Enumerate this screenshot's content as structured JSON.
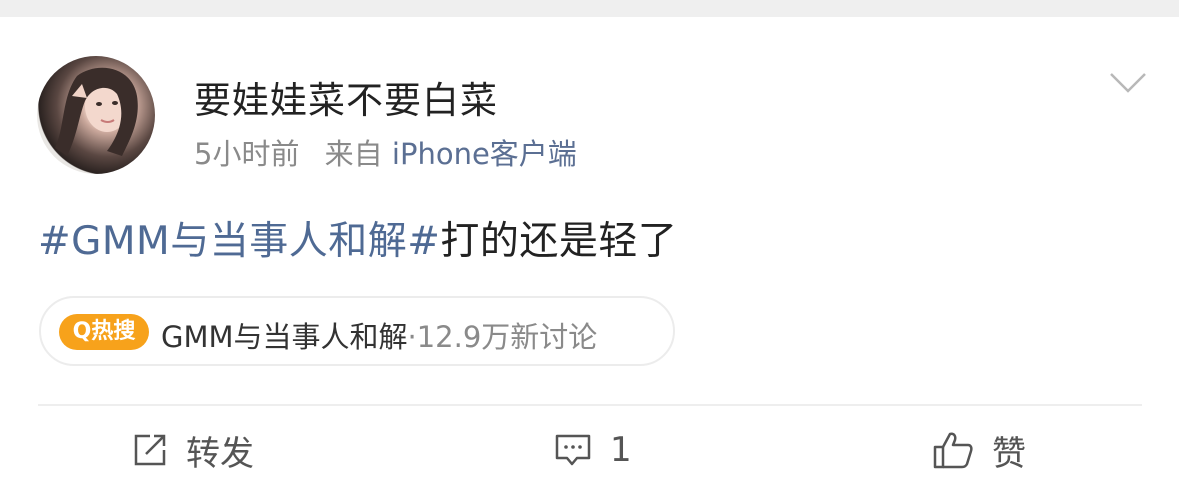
{
  "post": {
    "username": "要娃娃菜不要白菜",
    "time": "5小时前",
    "source_prefix": "来自",
    "source": "iPhone客户端",
    "content_tag": "#GMM与当事人和解#",
    "content_text": "打的还是轻了"
  },
  "hot_search": {
    "badge": "Q热搜",
    "topic": "GMM与当事人和解",
    "count": "·12.9万新讨论"
  },
  "actions": {
    "repost_label": "转发",
    "comment_count": "1",
    "like_label": "赞"
  },
  "colors": {
    "link": "#4f6a94",
    "badge": "#f7a21b",
    "meta": "#8a8a8a"
  },
  "icons": [
    "chevron-down-icon",
    "repost-icon",
    "comment-icon",
    "like-icon"
  ]
}
